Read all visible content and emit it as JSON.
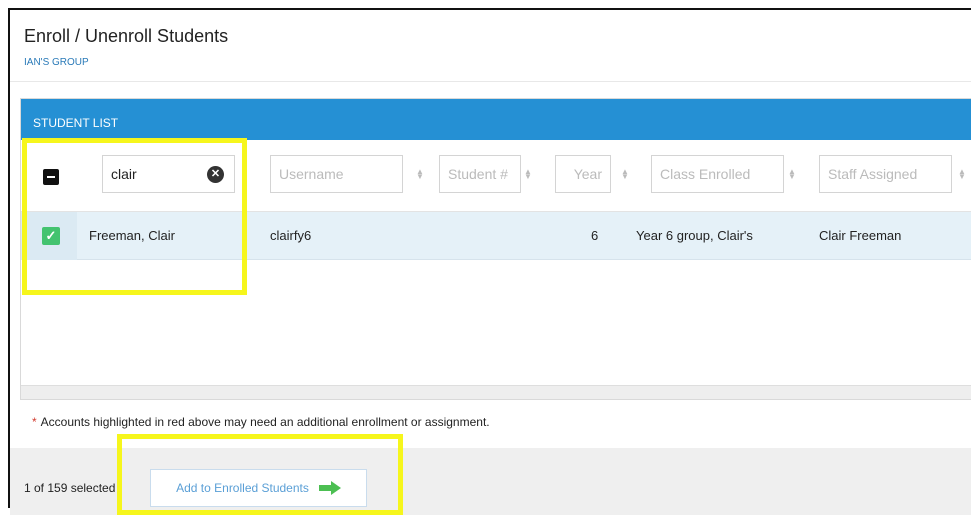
{
  "page": {
    "title": "Enroll / Unenroll Students",
    "group_link": "IAN'S GROUP"
  },
  "student_list": {
    "header": "STUDENT LIST",
    "filters": {
      "name_value": "clair",
      "username_placeholder": "Username",
      "student_number_placeholder": "Student #",
      "year_placeholder": "Year",
      "class_placeholder": "Class Enrolled",
      "staff_placeholder": "Staff Assigned"
    },
    "rows": [
      {
        "name": "Freeman, Clair",
        "username": "clairfy6",
        "student_number": "",
        "year": "6",
        "class_enrolled": "Year 6 group, Clair's",
        "staff_assigned": "Clair Freeman",
        "selected": true
      }
    ]
  },
  "note": {
    "star": "*",
    "text": "Accounts highlighted in red above may need an additional enrollment or assignment."
  },
  "footer": {
    "selected_count": "1 of 159 selected",
    "add_button_label": "Add to Enrolled Students"
  },
  "icons": {
    "clear": "clear-icon",
    "sort": "sort-icon",
    "check": "check-icon",
    "arrow": "arrow-right-icon",
    "minus": "minus-icon"
  },
  "colors": {
    "header_blue": "#2590d4",
    "row_selected": "#e5f1f8",
    "check_green": "#43c36f",
    "arrow_green": "#4cbf52",
    "button_text": "#5a9fd6",
    "highlight_yellow": "#f6f61c",
    "required_star": "#d23b2e"
  }
}
